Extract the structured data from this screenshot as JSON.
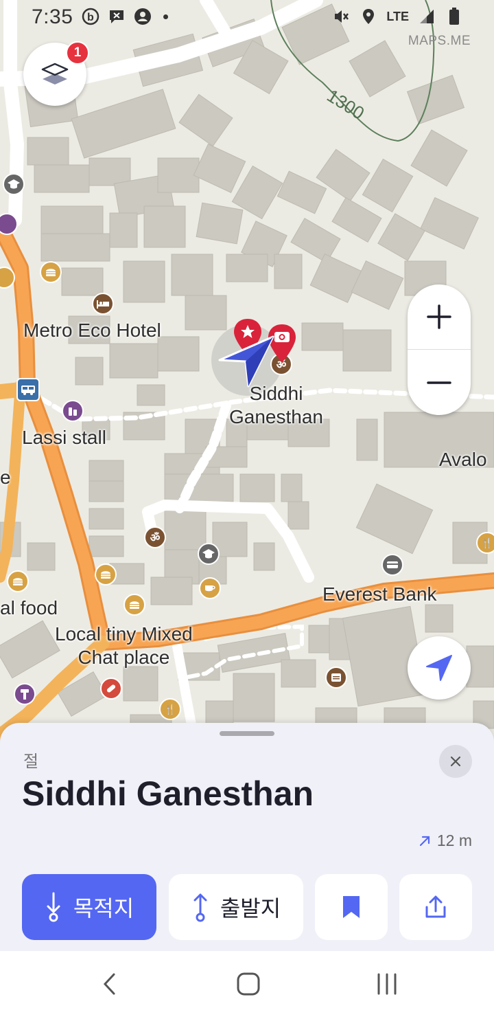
{
  "status_bar": {
    "time": "7:35",
    "network": "LTE",
    "icons_left": [
      "b-icon",
      "message-icon",
      "account-icon",
      "dot-icon"
    ],
    "icons_right": [
      "mute-icon",
      "location-pin-icon",
      "lte-icon",
      "signal-icon",
      "battery-icon"
    ]
  },
  "map": {
    "watermark": "MAPS.ME",
    "layers_badge": "1",
    "contour_label": "1300",
    "labels": {
      "metro_eco_hotel": "Metro Eco Hotel",
      "siddhi_ganesthan": "Siddhi\nGanesthan",
      "lassi_stall": "Lassi stall",
      "avalo": "Avalo",
      "e": "e",
      "al_food": "al food",
      "local_tiny": "Local tiny Mixed\nChat place",
      "everest_bank": "Everest Bank"
    }
  },
  "place_sheet": {
    "category": "절",
    "title": "Siddhi Ganesthan",
    "distance": "12 m",
    "actions": {
      "destination": "목적지",
      "start": "출발지"
    }
  },
  "colors": {
    "accent": "#5467f2",
    "road_orange": "#f7a24a",
    "building": "#c9c7be",
    "map_bg": "#ecebe3"
  }
}
